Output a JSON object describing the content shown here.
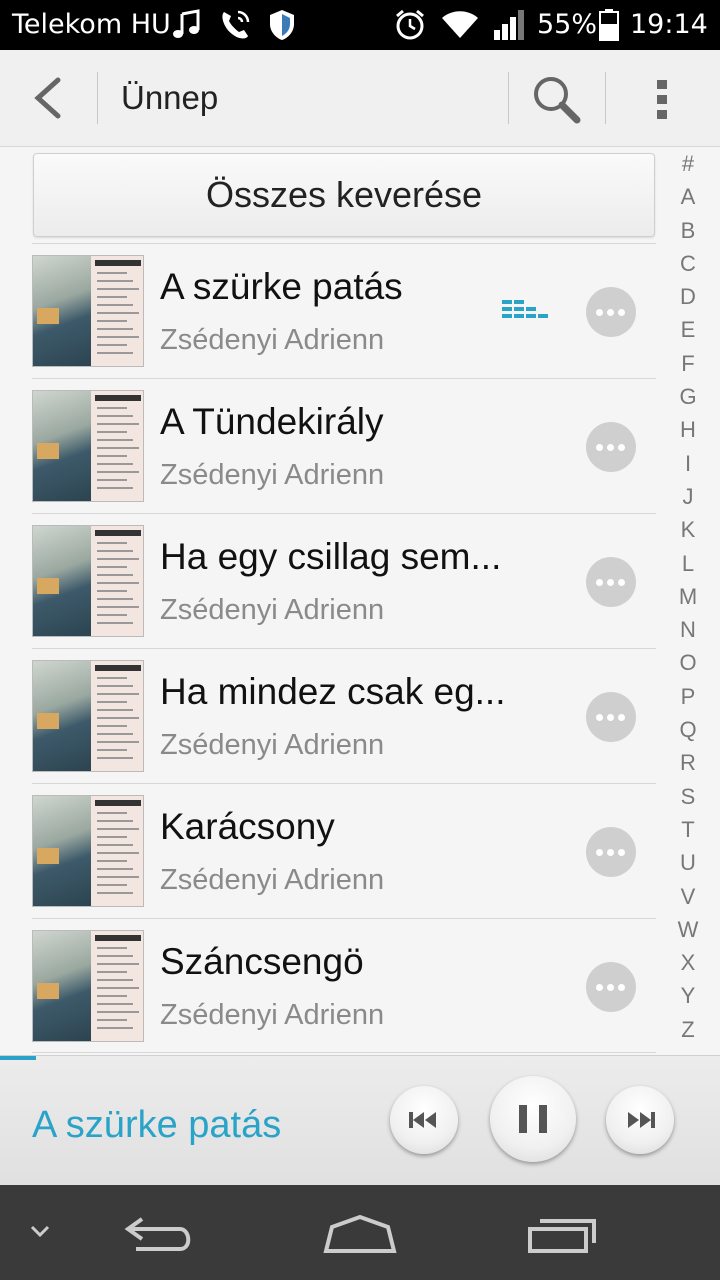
{
  "status_bar": {
    "carrier": "Telekom HU",
    "battery_percent": "55%",
    "time": "19:14",
    "icons": [
      "music-note-icon",
      "phone-call-icon",
      "shield-icon",
      "alarm-icon",
      "wifi-icon",
      "signal-icon",
      "battery-icon"
    ]
  },
  "action_bar": {
    "title": "Ünnep",
    "icons": [
      "back-icon",
      "search-icon",
      "overflow-menu-icon"
    ]
  },
  "shuffle_label": "Összes keverése",
  "songs": [
    {
      "title": "A szürke patás",
      "artist": "Zsédenyi Adrienn",
      "playing": true
    },
    {
      "title": "A Tündekirály",
      "artist": "Zsédenyi Adrienn",
      "playing": false
    },
    {
      "title": "Ha egy csillag sem...",
      "artist": "Zsédenyi Adrienn",
      "playing": false
    },
    {
      "title": "Ha mindez csak eg...",
      "artist": "Zsédenyi Adrienn",
      "playing": false
    },
    {
      "title": "Karácsony",
      "artist": "Zsédenyi Adrienn",
      "playing": false
    },
    {
      "title": "Száncsengö",
      "artist": "Zsédenyi Adrienn",
      "playing": false
    }
  ],
  "alphabet_index": [
    "#",
    "A",
    "B",
    "C",
    "D",
    "E",
    "F",
    "G",
    "H",
    "I",
    "J",
    "K",
    "L",
    "M",
    "N",
    "O",
    "P",
    "Q",
    "R",
    "S",
    "T",
    "U",
    "V",
    "W",
    "X",
    "Y",
    "Z"
  ],
  "now_playing": {
    "title": "A szürke patás",
    "progress_fraction": 0.05,
    "controls": [
      "previous-icon",
      "pause-icon",
      "next-icon"
    ]
  },
  "nav_bar": {
    "icons": [
      "chevron-down-icon",
      "back-nav-icon",
      "home-icon",
      "recents-icon"
    ]
  },
  "colors": {
    "accent": "#2aa3c8",
    "status_bar_bg": "#000000",
    "nav_bar_bg": "#3a3a3a"
  }
}
